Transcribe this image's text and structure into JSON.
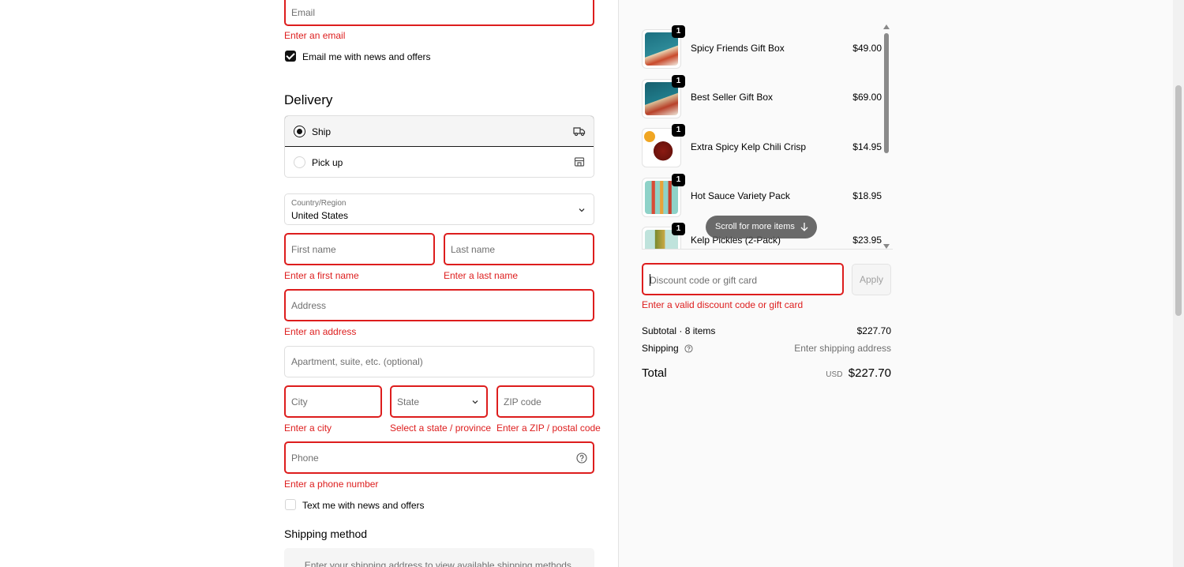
{
  "contact": {
    "email_placeholder": "Email",
    "email_error": "Enter an email",
    "newsletter_label": "Email me with news and offers",
    "newsletter_checked": true
  },
  "delivery": {
    "heading": "Delivery",
    "options": [
      {
        "label": "Ship",
        "selected": true,
        "icon": "truck-icon"
      },
      {
        "label": "Pick up",
        "selected": false,
        "icon": "store-icon"
      }
    ],
    "country_label": "Country/Region",
    "country_value": "United States",
    "first_name_placeholder": "First name",
    "first_name_error": "Enter a first name",
    "last_name_placeholder": "Last name",
    "last_name_error": "Enter a last name",
    "address_placeholder": "Address",
    "address_error": "Enter an address",
    "apartment_placeholder": "Apartment, suite, etc. (optional)",
    "city_placeholder": "City",
    "city_error": "Enter a city",
    "state_placeholder": "State",
    "state_error": "Select a state / province",
    "zip_placeholder": "ZIP code",
    "zip_error": "Enter a ZIP / postal code",
    "phone_placeholder": "Phone",
    "phone_error": "Enter a phone number",
    "sms_label": "Text me with news and offers",
    "sms_checked": false
  },
  "shipping_method": {
    "heading": "Shipping method",
    "notice": "Enter your shipping address to view available shipping methods."
  },
  "cart": {
    "items": [
      {
        "name": "Spicy Friends Gift Box",
        "price": "$49.00",
        "qty": "1"
      },
      {
        "name": "Best Seller Gift Box",
        "price": "$69.00",
        "qty": "1"
      },
      {
        "name": "Extra Spicy Kelp Chili Crisp",
        "price": "$14.95",
        "qty": "1"
      },
      {
        "name": "Hot Sauce Variety Pack",
        "price": "$18.95",
        "qty": "1"
      },
      {
        "name": "Kelp Pickles (2-Pack)",
        "price": "$23.95",
        "qty": "1"
      }
    ],
    "scroll_hint": "Scroll for more items"
  },
  "discount": {
    "placeholder": "Discount code or gift card",
    "apply_label": "Apply",
    "error": "Enter a valid discount code or gift card"
  },
  "summary": {
    "subtotal_label": "Subtotal · 8 items",
    "subtotal_value": "$227.70",
    "shipping_label": "Shipping",
    "shipping_value": "Enter shipping address",
    "total_label": "Total",
    "currency": "USD",
    "total_value": "$227.70"
  },
  "colors": {
    "error": "#dd1d1d",
    "accent": "#111111",
    "summary_bg": "#fafafa"
  }
}
